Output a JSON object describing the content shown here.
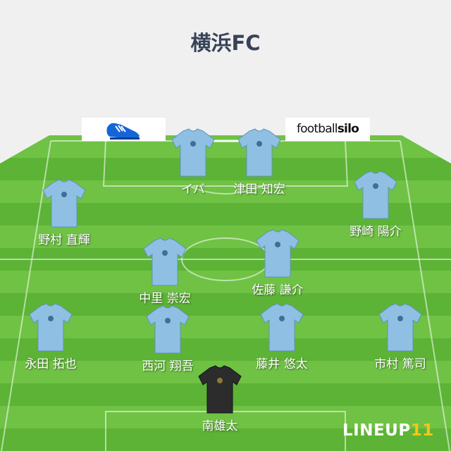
{
  "title": "横浜FC",
  "sponsors": {
    "left_icon": "football-boot-icon",
    "right_text_regular": "football",
    "right_text_bold": "silo"
  },
  "players": [
    {
      "id": "fw-left",
      "name": "イバ",
      "kit": "outfield"
    },
    {
      "id": "fw-right",
      "name": "津田 知宏",
      "kit": "outfield"
    },
    {
      "id": "wing-left",
      "name": "野村 直輝",
      "kit": "outfield"
    },
    {
      "id": "wing-right",
      "name": "野崎 陽介",
      "kit": "outfield"
    },
    {
      "id": "cm-left",
      "name": "中里 崇宏",
      "kit": "outfield"
    },
    {
      "id": "cm-right",
      "name": "佐藤 謙介",
      "kit": "outfield"
    },
    {
      "id": "lb",
      "name": "永田 拓也",
      "kit": "outfield"
    },
    {
      "id": "cb-left",
      "name": "西河 翔吾",
      "kit": "outfield"
    },
    {
      "id": "cb-right",
      "name": "藤井 悠太",
      "kit": "outfield"
    },
    {
      "id": "rb",
      "name": "市村 篤司",
      "kit": "outfield"
    },
    {
      "id": "gk",
      "name": "南雄太",
      "kit": "goalkeeper"
    }
  ],
  "branding": {
    "word": "LINEUP",
    "number": "11"
  },
  "colors": {
    "outfield_kit": "#8fc0e4",
    "goalkeeper_kit": "#2c2c2c",
    "pitch_light": "#6fc244",
    "pitch_dark": "#5cb335",
    "title": "#374359",
    "logo_accent": "#f5c518"
  }
}
